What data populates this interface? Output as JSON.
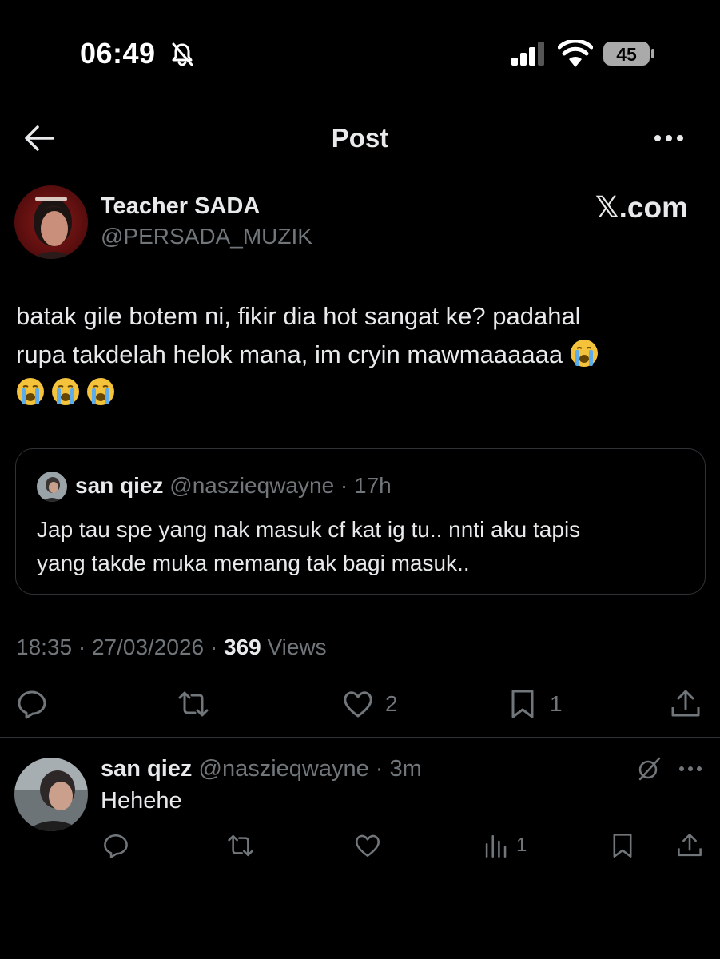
{
  "status_bar": {
    "time": "06:49",
    "battery": "45"
  },
  "header": {
    "title": "Post"
  },
  "post": {
    "author_name": "Teacher SADA",
    "author_handle": "@PERSADA_MUZIK",
    "watermark": "𝕏.com",
    "text_line_1": "batak gile botem ni, fikir dia hot sangat ke? padahal",
    "text_line_2": "rupa takdelah helok mana, im cryin mawmaaaaaa",
    "emoji": "loudly-crying-face",
    "timestamp": "18:35 · 27/03/2026 · ",
    "views_count": "369",
    "views_label": " Views",
    "likes": "2",
    "bookmarks": "1"
  },
  "quote": {
    "name": "san qiez",
    "handle": "@naszieqwayne",
    "dot": " · ",
    "time": "17h",
    "text_line_1": "Jap tau spe yang nak masuk cf kat ig tu.. nnti aku tapis",
    "text_line_2": "yang takde muka memang tak bagi masuk.."
  },
  "reply": {
    "name": "san qiez",
    "handle": "@naszieqwayne",
    "dot": " · ",
    "time": "3m",
    "text": "Hehehe",
    "views": "1"
  },
  "colors": {
    "background": "#000000",
    "text": "#e7e9ea",
    "muted": "#71767b",
    "border": "#2f3336"
  }
}
